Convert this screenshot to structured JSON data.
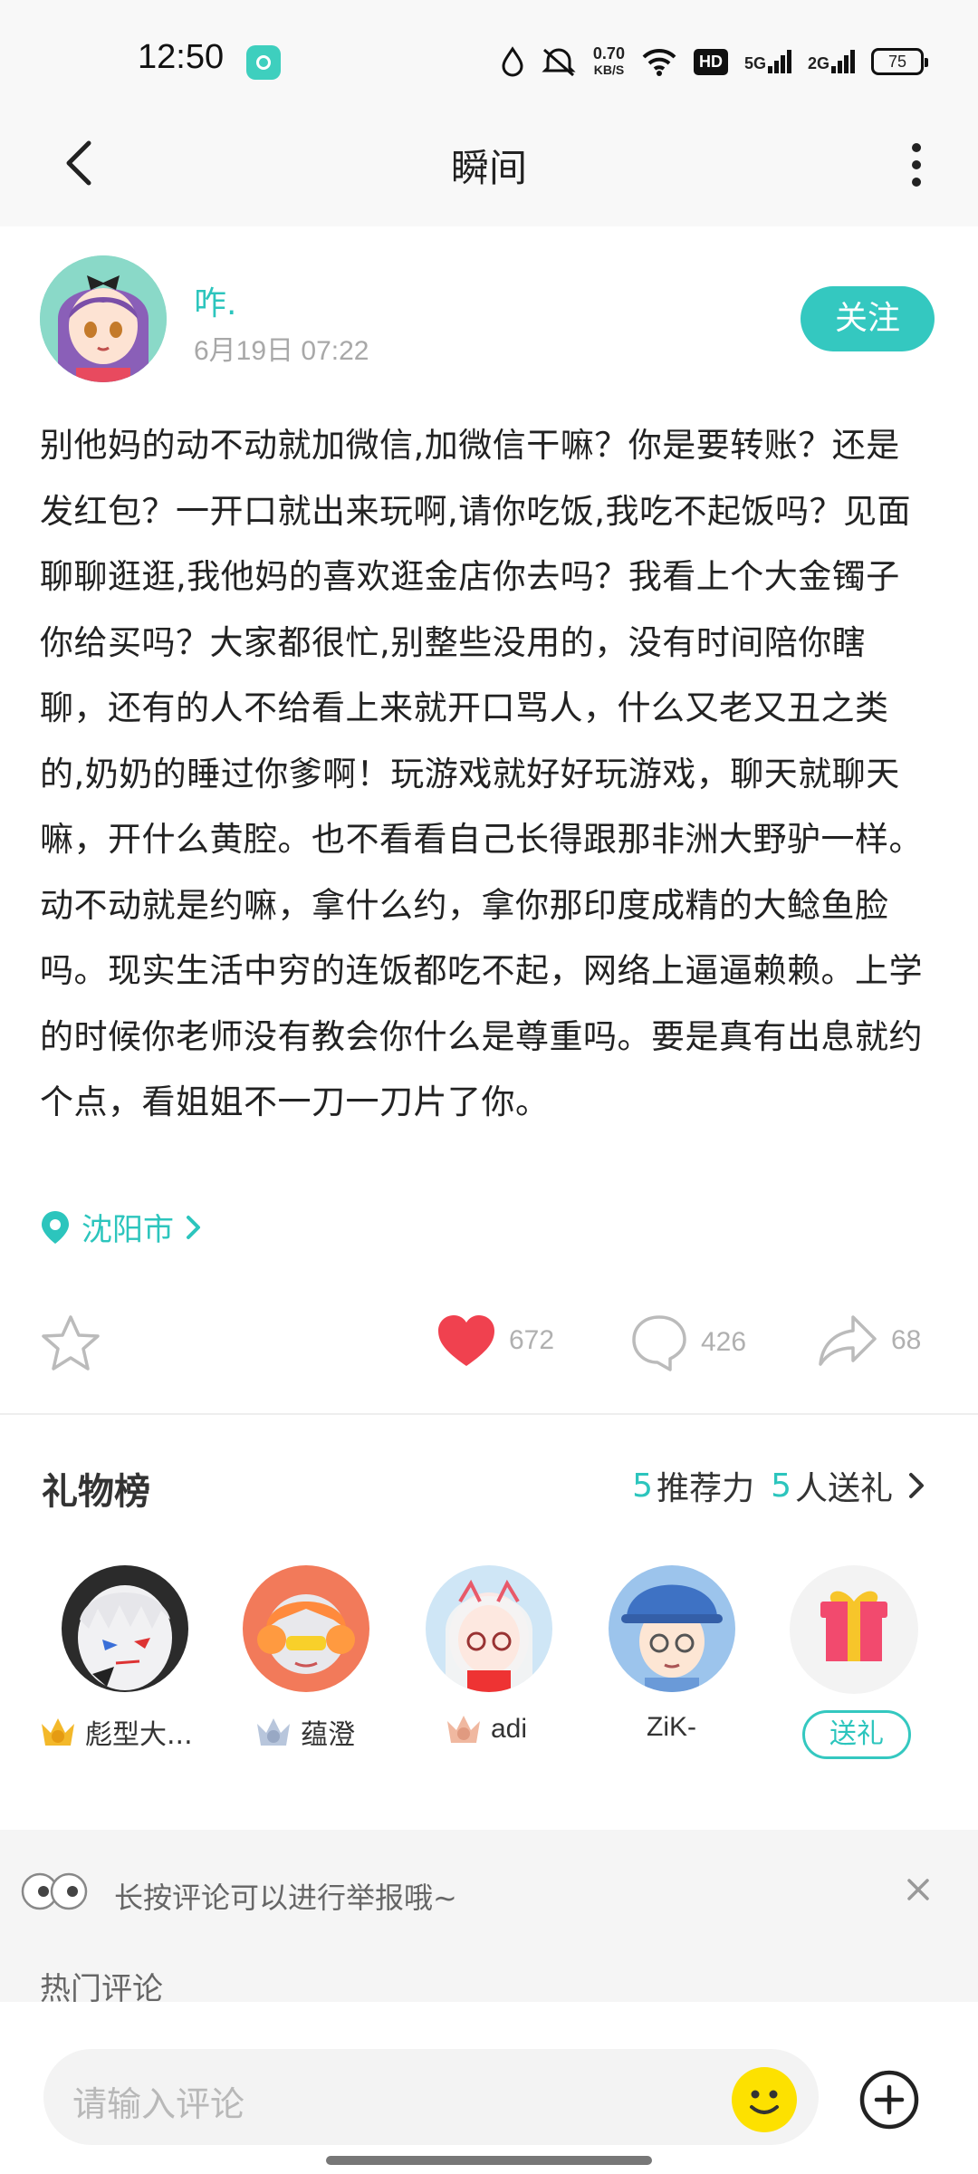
{
  "status_bar": {
    "time": "12:50",
    "speed_value": "0.70",
    "speed_unit": "KB/S",
    "hd_label": "HD",
    "signal1_label": "5G",
    "signal2_label": "2G",
    "battery": "75"
  },
  "header": {
    "title": "瞬间"
  },
  "post": {
    "author_name": "咋.",
    "time": "6月19日 07:22",
    "follow_label": "关注",
    "content": "别他妈的动不动就加微信,加微信干嘛？你是要转账？还是发红包？一开口就出来玩啊,请你吃饭,我吃不起饭吗？见面聊聊逛逛,我他妈的喜欢逛金店你去吗？我看上个大金镯子你给买吗？大家都很忙,别整些没用的，没有时间陪你瞎聊，还有的人不给看上来就开口骂人，什么又老又丑之类的,奶奶的睡过你爹啊！玩游戏就好好玩游戏，聊天就聊天嘛，开什么黄腔。也不看看自己长得跟那非洲大野驴一样。动不动就是约嘛，拿什么约，拿你那印度成精的大鲶鱼脸吗。现实生活中穷的连饭都吃不起，网络上逼逼赖赖。上学的时候你老师没有教会你什么是尊重吗。要是真有出息就约个点，看姐姐不一刀一刀片了你。",
    "location": "沈阳市"
  },
  "actions": {
    "likes": "672",
    "comments": "426",
    "shares": "68"
  },
  "gifts": {
    "title": "礼物榜",
    "recommend_count": "5",
    "recommend_label": "推荐力",
    "givers_count": "5",
    "givers_label": "人送礼",
    "givers": [
      {
        "name": "彪型大...",
        "rank": "1"
      },
      {
        "name": "蕴澄",
        "rank": "2"
      },
      {
        "name": "adi",
        "rank": "3"
      },
      {
        "name": "ZiK-"
      }
    ],
    "send_label": "送礼"
  },
  "comments": {
    "tip": "长按评论可以进行举报哦~",
    "hot_label": "热门评论",
    "input_placeholder": "请输入评论"
  },
  "colors": {
    "accent": "#34c8c0",
    "like": "#f0414f"
  }
}
